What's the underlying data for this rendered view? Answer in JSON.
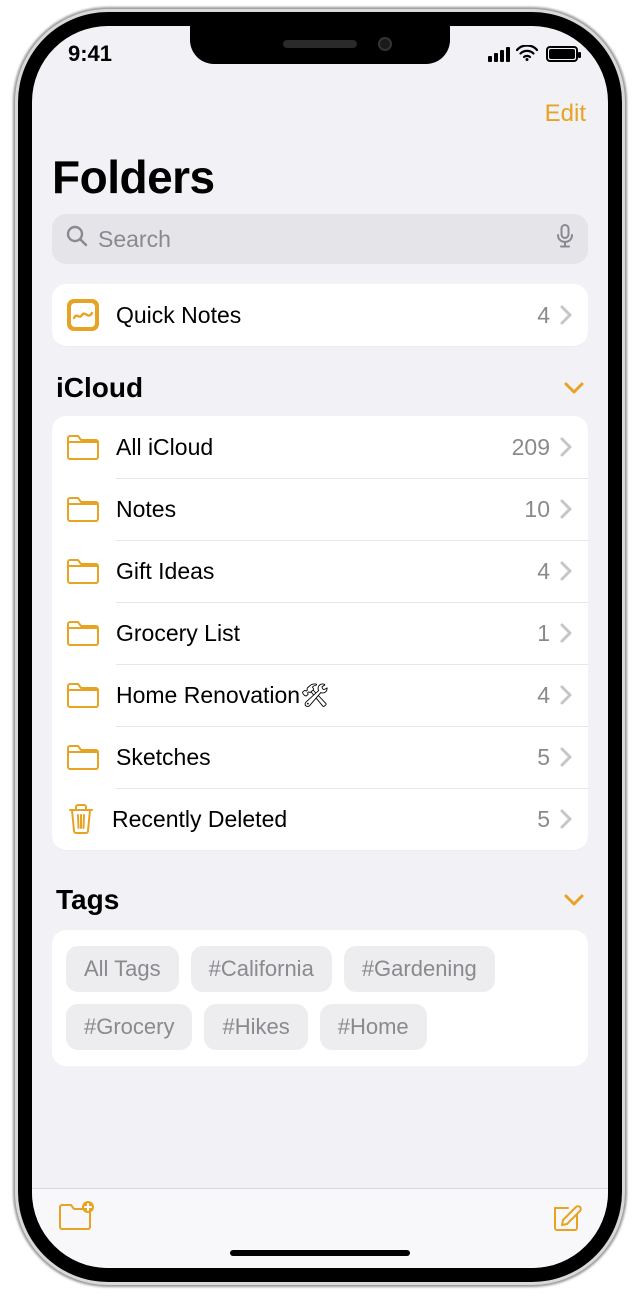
{
  "status": {
    "time": "9:41"
  },
  "nav": {
    "edit": "Edit"
  },
  "title": "Folders",
  "search": {
    "placeholder": "Search"
  },
  "quick_notes": {
    "label": "Quick Notes",
    "count": "4"
  },
  "sections": {
    "icloud": {
      "title": "iCloud",
      "items": [
        {
          "icon": "folder",
          "label": "All iCloud",
          "count": "209"
        },
        {
          "icon": "folder",
          "label": "Notes",
          "count": "10"
        },
        {
          "icon": "folder",
          "label": "Gift Ideas",
          "count": "4"
        },
        {
          "icon": "folder",
          "label": "Grocery List",
          "count": "1"
        },
        {
          "icon": "folder",
          "label": "Home Renovation🛠",
          "count": "4"
        },
        {
          "icon": "folder",
          "label": "Sketches",
          "count": "5"
        },
        {
          "icon": "trash",
          "label": "Recently Deleted",
          "count": "5"
        }
      ]
    },
    "tags": {
      "title": "Tags",
      "items": [
        "All Tags",
        "#California",
        "#Gardening",
        "#Grocery",
        "#Hikes",
        "#Home"
      ]
    }
  },
  "colors": {
    "accent": "#e7a323",
    "bg": "#f2f2f6"
  }
}
